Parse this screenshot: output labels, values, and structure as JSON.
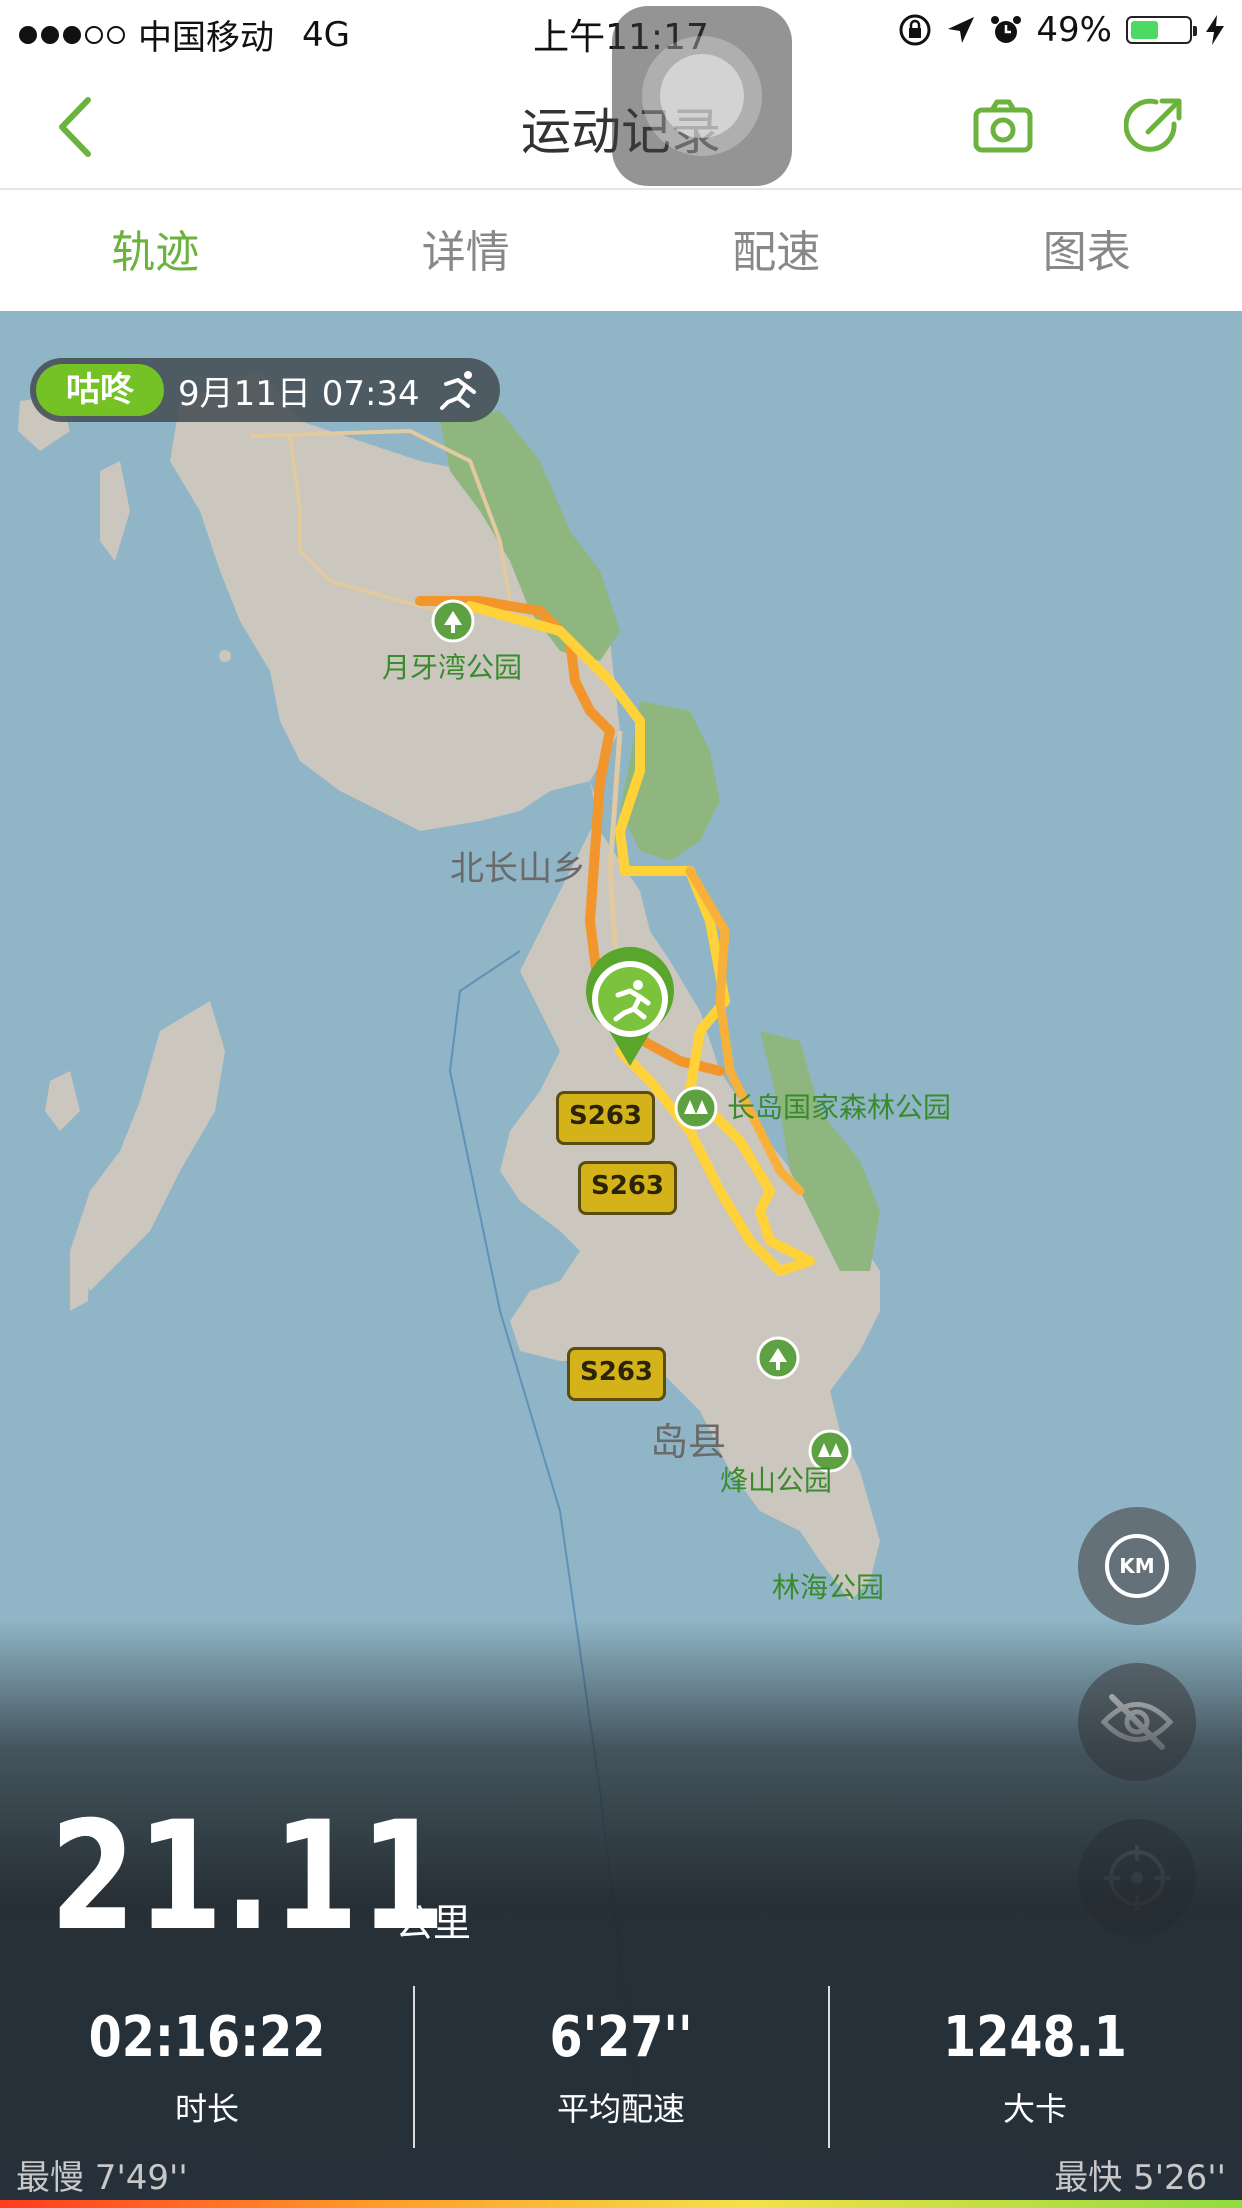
{
  "status_bar": {
    "carrier": "中国移动",
    "network": "4G",
    "time": "上午11:17",
    "battery_percent": "49%",
    "battery_level": 0.49
  },
  "nav": {
    "title": "运动记录"
  },
  "tabs": [
    {
      "label": "轨迹",
      "active": true
    },
    {
      "label": "详情",
      "active": false
    },
    {
      "label": "配速",
      "active": false
    },
    {
      "label": "图表",
      "active": false
    }
  ],
  "record": {
    "tag": "咕咚",
    "datetime": "9月11日 07:34",
    "activity_icon": "running-icon"
  },
  "map": {
    "labels": {
      "park1": "月牙湾公园",
      "town": "北长山乡",
      "forest_park": "长岛国家森林公园",
      "county": "岛县",
      "park2": "烽山公园",
      "park3": "林海公园"
    },
    "roads": [
      "S263",
      "S263",
      "S263"
    ],
    "colors": {
      "water": "#8fb5c6",
      "land": "#cbc7bf",
      "park": "#8fb67e",
      "route_fast": "#ffd23a",
      "route_slow": "#f2962c"
    }
  },
  "summary": {
    "distance": "21.11",
    "distance_unit": "公里",
    "duration": "02:16:22",
    "duration_label": "时长",
    "avg_pace": "6'27''",
    "avg_pace_label": "平均配速",
    "calories": "1248.1",
    "calories_label": "大卡",
    "slowest": "最慢 7'49''",
    "fastest": "最快 5'26''"
  },
  "brand": {
    "accent": "#6cb33e"
  }
}
